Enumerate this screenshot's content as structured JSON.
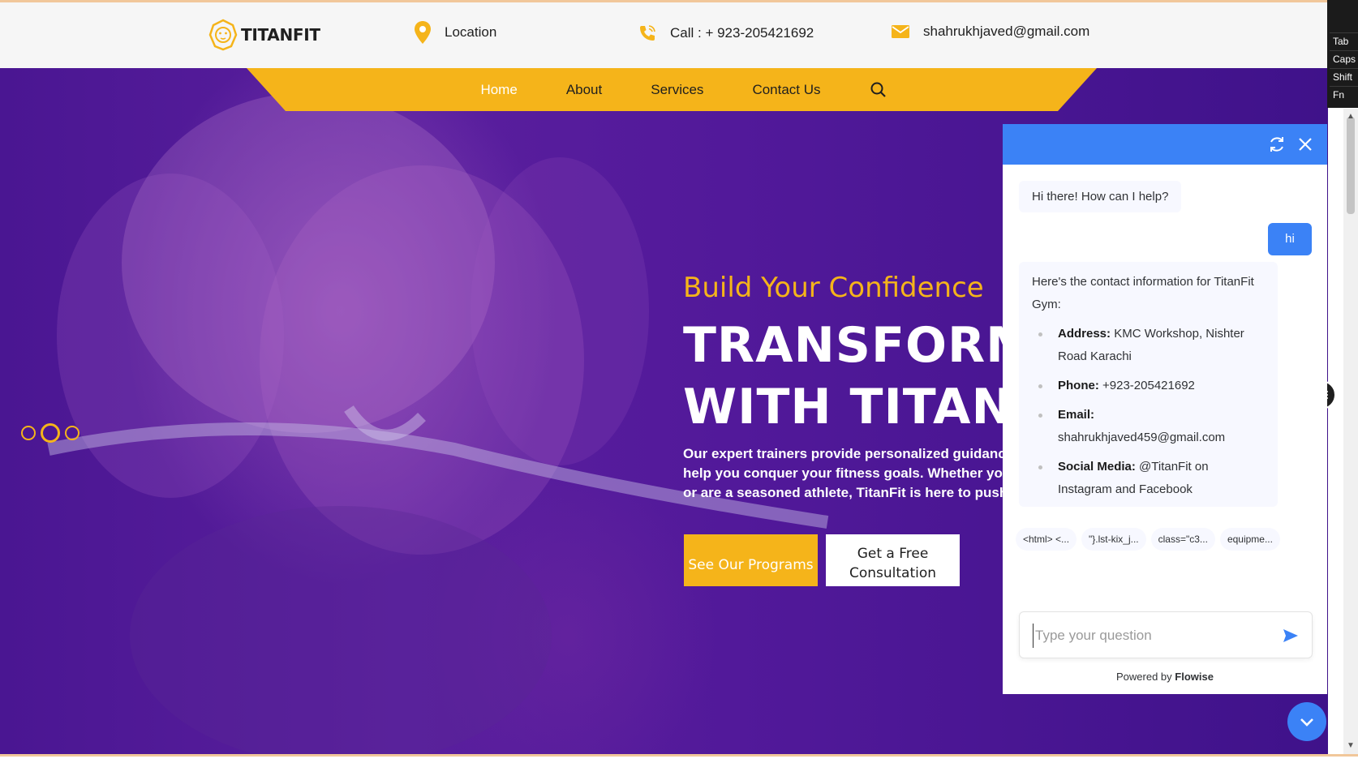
{
  "header": {
    "brand": "TITANFIT",
    "location_label": "Location",
    "call_label": "Call : + 923-205421692",
    "email_label": "shahrukhjaved@gmail.com"
  },
  "nav": {
    "items": [
      "Home",
      "About",
      "Services",
      "Contact Us"
    ],
    "active": "Home"
  },
  "hero": {
    "subtitle": "Build Your Confidence",
    "title_line1": "TRANSFORM",
    "title_line2": "WITH TITANF",
    "desc_line1": "Our expert trainers provide personalized guidance",
    "desc_line2": "help you conquer your fitness goals. Whether you",
    "desc_line3": "or are a seasoned athlete, TitanFit is here to push",
    "btn_programs": "See Our Programs",
    "btn_consult_line1": "Get a Free",
    "btn_consult_line2": "Consultation"
  },
  "keyboard": [
    "Tab",
    "Caps",
    "Shift",
    "Fn"
  ],
  "chat": {
    "greeting": "Hi there! How can I help?",
    "user_msg": "hi",
    "reply_intro": "Here's the contact information for TitanFit Gym:",
    "reply_items": [
      {
        "label": "Address:",
        "value": "KMC Workshop, Nishter Road Karachi"
      },
      {
        "label": "Phone:",
        "value": "+923-205421692"
      },
      {
        "label": "Email:",
        "value": "shahrukhjaved459@gmail.com"
      },
      {
        "label": "Social Media:",
        "value": "@TitanFit on Instagram and Facebook"
      }
    ],
    "chips": [
      "<html> <...",
      "\"}.lst-kix_j...",
      "class=\"c3...",
      "equipme..."
    ],
    "input_placeholder": "Type your question",
    "powered_prefix": "Powered by ",
    "powered_brand": "Flowise"
  },
  "colors": {
    "accent_yellow": "#f5b41a",
    "hero_purple": "#4a1692",
    "chat_blue": "#3b82f6"
  }
}
